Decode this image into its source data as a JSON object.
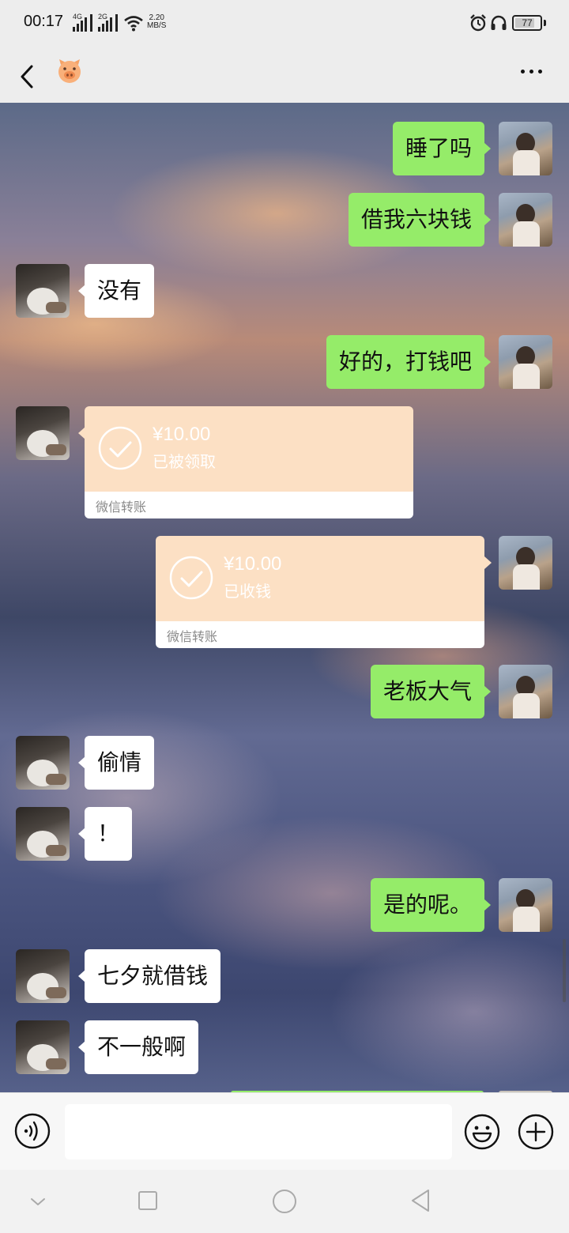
{
  "status_bar": {
    "time": "00:17",
    "sim1": "4G",
    "sim2": "2G",
    "speed_value": "2.20",
    "speed_unit": "MB/S",
    "battery": "77"
  },
  "chat": {
    "messages": [
      {
        "from": "me",
        "text": "睡了吗"
      },
      {
        "from": "me",
        "text": "借我六块钱"
      },
      {
        "from": "them",
        "text": "没有"
      },
      {
        "from": "me",
        "text": "好的，打钱吧"
      },
      {
        "from": "them",
        "type": "transfer",
        "amount": "¥10.00",
        "status": "已被领取",
        "label": "微信转账"
      },
      {
        "from": "me",
        "type": "transfer",
        "amount": "¥10.00",
        "status": "已收钱",
        "label": "微信转账"
      },
      {
        "from": "me",
        "text": "老板大气"
      },
      {
        "from": "them",
        "text": "偷情"
      },
      {
        "from": "them",
        "text": "！"
      },
      {
        "from": "me",
        "text": "是的呢。"
      },
      {
        "from": "them",
        "text": "七夕就借钱"
      },
      {
        "from": "them",
        "text": "不一般啊"
      }
    ]
  },
  "icons": {
    "back": "chevron-left-icon",
    "pig": "pig-emoji-icon",
    "more": "more-dots-icon",
    "voice": "voice-icon",
    "emoji": "smile-icon",
    "plus": "plus-icon"
  },
  "colors": {
    "my_bubble": "#95ec69",
    "their_bubble": "#ffffff",
    "transfer_card": "#fce0c4",
    "bar_bg": "#ededed"
  }
}
